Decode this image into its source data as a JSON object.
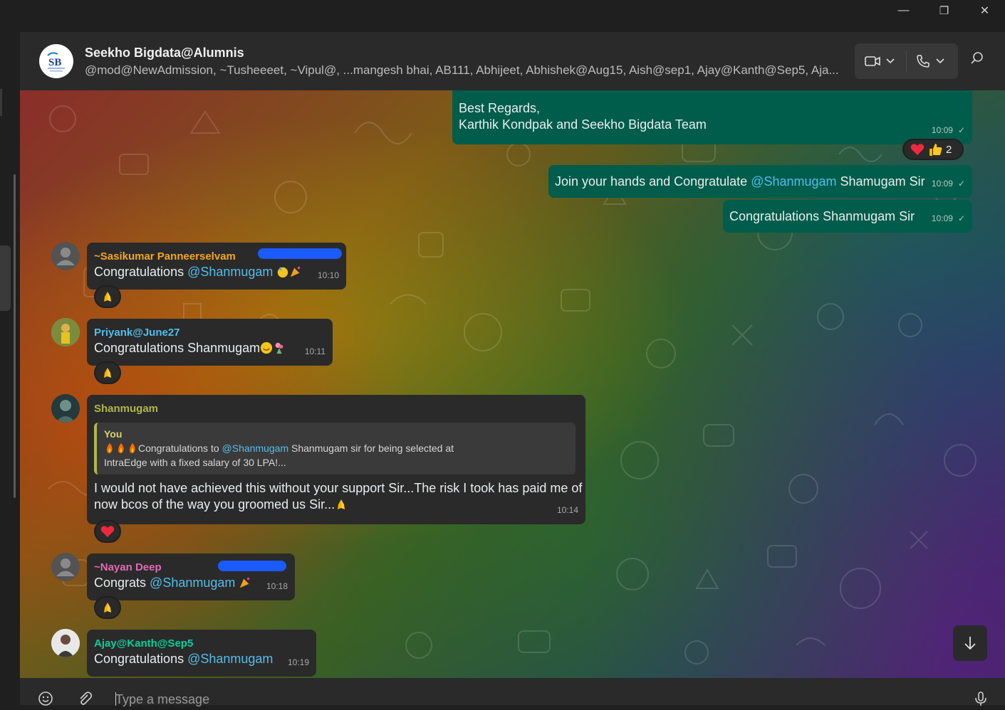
{
  "window": {
    "minimize_label": "—",
    "restore_label": "❐",
    "close_label": "✕"
  },
  "header": {
    "group_name": "Seekho Bigdata@Alumnis",
    "members": "@mod@NewAdmission, ~Tusheeeet, ~Vipul@, ...mangesh bhai, AB111, Abhijeet, Abhishek@Aug15, Aish@sep1, Ajay@Kanth@Sep5, Aja...",
    "avatar_text": "SB"
  },
  "messages": {
    "m1": {
      "line1": "Best Regards,",
      "line2": "Karthik Kondpak and Seekho Bigdata Team",
      "time": "10:09",
      "reaction_count": "2"
    },
    "m2": {
      "pre": "Join your hands and Congratulate ",
      "mention": "@Shanmugam",
      "post": " Shamugam Sir",
      "time": "10:09"
    },
    "m3": {
      "text": "Congratulations Shanmugam Sir",
      "time": "10:09"
    },
    "m4": {
      "sender": "~Sasikumar Panneerselvam",
      "pre": "Congratulations ",
      "mention": "@Shanmugam",
      "time": "10:10",
      "sender_color": "#f5a623"
    },
    "m5": {
      "sender": "Priyank@June27",
      "text": "Congratulations Shanmugam",
      "time": "10:11",
      "sender_color": "#53bdeb"
    },
    "m6": {
      "sender": "Shanmugam",
      "sender_color": "#afb84b",
      "quote_name": "You",
      "quote_pre": "Congratulations to ",
      "quote_mention": "@Shanmugam",
      "quote_post": "  Shanmugam sir for being selected at",
      "quote_line2": "IntraEdge with a fixed salary of 30 LPA!...",
      "line1": "I would not have achieved this without your support Sir...The risk I took has paid me of",
      "line2": "now bcos of the way you groomed us Sir...",
      "time": "10:14"
    },
    "m7": {
      "sender": "~Nayan Deep",
      "pre": "Congrats ",
      "mention": "@Shanmugam",
      "time": "10:18",
      "sender_color": "#e26ab6"
    },
    "m8": {
      "sender": "Ajay@Kanth@Sep5",
      "pre": "Congratulations ",
      "mention": "@Shanmugam",
      "time": "10:19",
      "sender_color": "#06cf9c"
    }
  },
  "composer": {
    "placeholder": "Type a message"
  },
  "icons": [
    "video-call-icon",
    "voice-call-icon",
    "search-icon",
    "emoji-icon",
    "attach-icon",
    "mic-icon",
    "arrow-down-icon",
    "heart-icon",
    "thumbs-up-icon",
    "folded-hands-icon",
    "party-popper-icon",
    "smile-icon",
    "bouquet-icon",
    "fire-icon"
  ],
  "colors": {
    "outgoing_bubble": "#005c4b",
    "incoming_bubble": "#2a2a2a",
    "mention": "#53bdeb",
    "header_bg": "#2a2a2a"
  }
}
